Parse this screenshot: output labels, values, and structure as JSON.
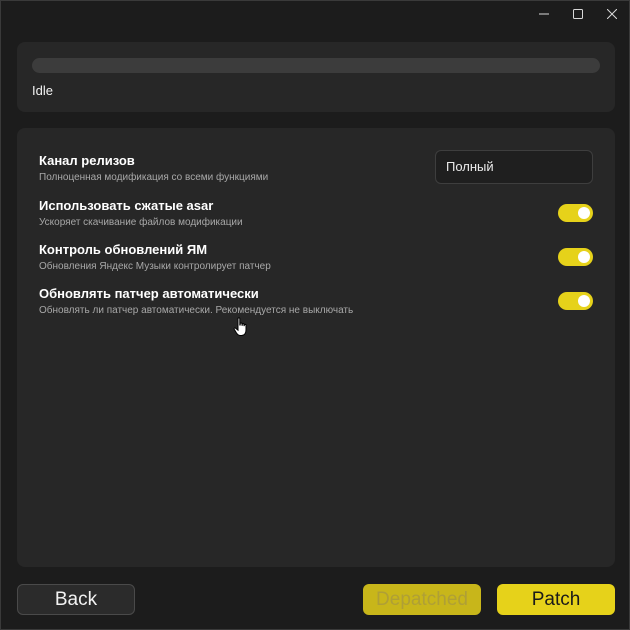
{
  "window": {
    "controls": [
      "minimize-icon",
      "maximize-icon",
      "close-icon"
    ]
  },
  "status": {
    "progress": 0,
    "text": "Idle"
  },
  "settings": {
    "release_channel": {
      "title": "Канал релизов",
      "description": "Полноценная модификация со всеми функциями",
      "value": "Полный"
    },
    "compressed_asar": {
      "title": "Использовать сжатые asar",
      "description": "Ускоряет скачивание файлов модификации",
      "enabled": true
    },
    "ym_update_control": {
      "title": "Контроль обновлений ЯМ",
      "description": "Обновления Яндекс Музыки контролирует патчер",
      "enabled": true
    },
    "auto_update_patcher": {
      "title": "Обновлять патчер автоматически",
      "description": "Обновлять ли патчер автоматически. Рекомендуется не выключать",
      "enabled": true
    }
  },
  "buttons": {
    "back": "Back",
    "depatched": "Depatched",
    "patch": "Patch"
  },
  "colors": {
    "accent": "#e6d21a",
    "background": "#1c1c1c",
    "panel": "#272727"
  }
}
